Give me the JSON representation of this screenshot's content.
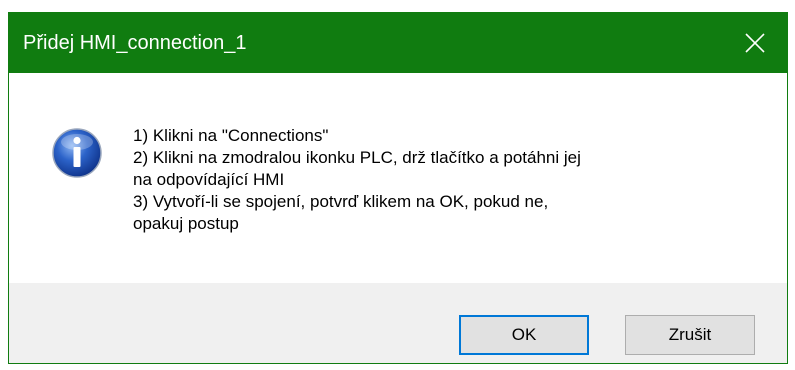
{
  "dialog": {
    "title": "Přidej HMI_connection_1",
    "close_glyph": "✕",
    "icon": "info-icon",
    "message_lines": [
      "1) Klikni na \"Connections\"",
      "2) Klikni na zmodralou ikonku PLC, drž tlačítko a potáhni jej",
      "na odpovídající HMI",
      "3) Vytvoří-li se spojení, potvrď klikem na OK, pokud ne,",
      "opakuj postup"
    ],
    "buttons": {
      "ok": "OK",
      "cancel": "Zrušit"
    }
  },
  "colors": {
    "titlebar": "#107c10",
    "footer": "#f0f0f0",
    "focus": "#0078d7"
  }
}
